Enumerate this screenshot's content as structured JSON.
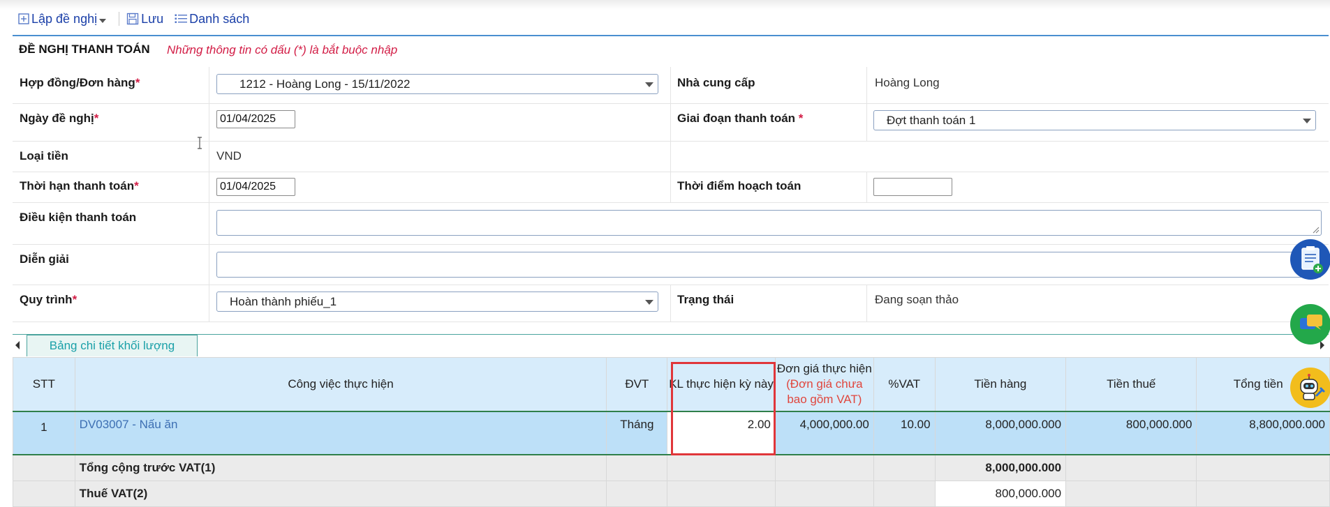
{
  "toolbar": {
    "create_label": "Lập đề nghị",
    "save_label": "Lưu",
    "list_label": "Danh sách"
  },
  "form": {
    "title": "ĐỀ NGHỊ THANH TOÁN",
    "notice": "Những thông tin có dấu (*) là bắt buộc nhập",
    "contract_label": "Hợp đồng/Đơn hàng",
    "contract_value": "1212 - Hoàng Long - 15/11/2022",
    "supplier_label": "Nhà cung cấp",
    "supplier_value": "Hoàng Long",
    "request_date_label": "Ngày đề nghị",
    "request_date_value": "01/04/2025",
    "payment_phase_label": "Giai đoạn thanh toán",
    "payment_phase_value": "Đợt thanh toán 1",
    "currency_label": "Loại tiền",
    "currency_value": "VND",
    "due_date_label": "Thời hạn thanh toán",
    "due_date_value": "01/04/2025",
    "accounting_time_label": "Thời điểm hoạch toán",
    "accounting_time_value": "",
    "terms_label": "Điều kiện thanh toán",
    "terms_value": "",
    "description_label": "Diễn giải",
    "description_value": "",
    "workflow_label": "Quy trình",
    "workflow_value": "Hoàn thành phiếu_1",
    "status_label": "Trạng thái",
    "status_value": "Đang soạn thảo",
    "required_mark": "*"
  },
  "tab": {
    "label": "Bảng chi tiết khối lượng"
  },
  "table": {
    "headers": {
      "stt": "STT",
      "task": "Công việc thực hiện",
      "unit": "ĐVT",
      "qty": "KL thực hiện kỳ này",
      "price_line1": "Đơn giá thực hiện",
      "price_line2": "(Đơn giá chưa",
      "price_line3": "bao gồm VAT)",
      "vat": "%VAT",
      "amount": "Tiền hàng",
      "tax": "Tiền thuế",
      "total": "Tổng tiền"
    },
    "rows": [
      {
        "stt": "1",
        "task": "DV03007 - Nấu ăn",
        "unit": "Tháng",
        "qty": "2.00",
        "price": "4,000,000.00",
        "vat": "10.00",
        "amount": "8,000,000.000",
        "tax": "800,000.000",
        "total": "8,800,000.000"
      }
    ],
    "subtotal_label": "Tổng cộng trước VAT(1)",
    "subtotal_value": "8,000,000.000",
    "vat_label": "Thuế VAT(2)",
    "vat_value": "800,000.000"
  },
  "colors": {
    "accent": "#1a3fa8",
    "required": "#d21c45",
    "tab_teal": "#1aa0a8",
    "row_selected": "#bde0f8",
    "header_bg": "#d7ecfb",
    "highlight": "#e0363a"
  },
  "icons": [
    "plus-square-icon",
    "caret-down-icon",
    "save-icon",
    "list-icon",
    "clipboard-add-icon",
    "chat-icon",
    "robot-support-icon"
  ]
}
